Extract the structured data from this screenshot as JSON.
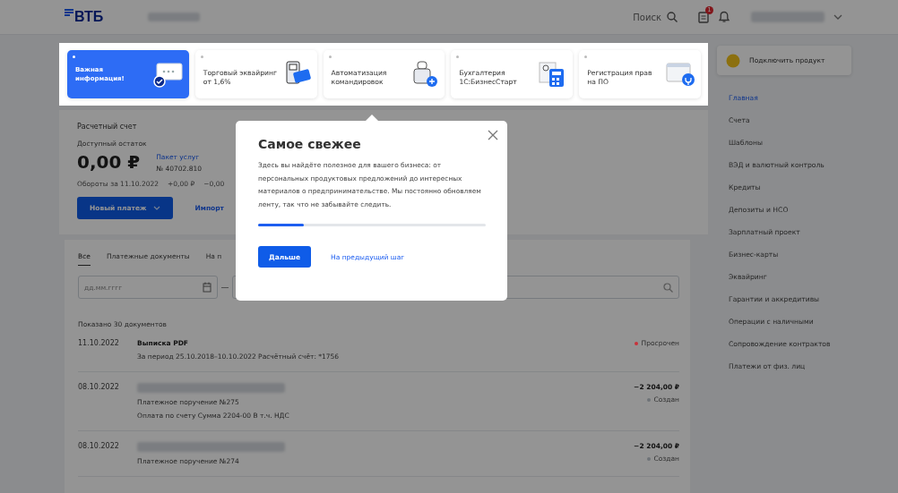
{
  "header": {
    "logo": "ВТБ",
    "search_label": "Поиск",
    "notification_badge": "1"
  },
  "stories": [
    {
      "text": "Важная информация!",
      "selected": true,
      "kind": "info"
    },
    {
      "text": "Торговый эквайринг от 1,6%",
      "selected": false,
      "kind": "terminal"
    },
    {
      "text": "Автоматизация командировок",
      "selected": false,
      "kind": "travel"
    },
    {
      "text": "Бухгалтерия 1С:БизнесСтарт",
      "selected": false,
      "kind": "calculator"
    },
    {
      "text": "Регистрация прав на ПО",
      "selected": false,
      "kind": "software"
    }
  ],
  "account": {
    "title": "Расчетный счет",
    "balance_label": "Доступный остаток",
    "balance": "0,00 ₽",
    "package_link": "Пакет услуг",
    "account_number": "№ 40702.810",
    "turnover_label": "Обороты за 11.10.2022",
    "turnover_in": "+0,00 ₽",
    "turnover_out": "−0,00",
    "new_payment_button": "Новый платеж",
    "import_link": "Импорт"
  },
  "documents": {
    "tabs": [
      {
        "label": "Все",
        "selected": true
      },
      {
        "label": "Платежные документы",
        "selected": false
      },
      {
        "label": "На п",
        "selected": false
      }
    ],
    "date_placeholder": "дд.мм.гггг",
    "count": "Показано 30 документов",
    "rows": [
      {
        "date": "11.10.2022",
        "title": "Выписка PDF",
        "lines": [
          "За период 25.10.2018–10.10.2022 Расчётный счёт: *1756"
        ],
        "amount": "",
        "status": "Просрочен",
        "color": "#c8323a",
        "counterparty_hidden": false
      },
      {
        "date": "08.10.2022",
        "title": "",
        "lines": [
          "Платежное поручение №275",
          "Оплата по счету Сумма 2204-00 В т.ч. НДС"
        ],
        "amount": "−2 204,00 ₽",
        "status": "Создан",
        "color": "#6e7378",
        "counterparty_hidden": true
      },
      {
        "date": "08.10.2022",
        "title": "",
        "lines": [
          "Платежное поручение №274"
        ],
        "amount": "−2 204,00 ₽",
        "status": "Создан",
        "color": "#6e7378",
        "counterparty_hidden": true
      }
    ]
  },
  "sidebar": {
    "connect_button": "Подключить продукт",
    "items": [
      {
        "label": "Главная",
        "selected": true
      },
      {
        "label": "Счета",
        "selected": false
      },
      {
        "label": "Шаблоны",
        "selected": false
      },
      {
        "label": "ВЭД и валютный контроль",
        "selected": false
      },
      {
        "label": "Кредиты",
        "selected": false
      },
      {
        "label": "Депозиты и НСО",
        "selected": false
      },
      {
        "label": "Зарплатный проект",
        "selected": false
      },
      {
        "label": "Бизнес-карты",
        "selected": false
      },
      {
        "label": "Эквайринг",
        "selected": false
      },
      {
        "label": "Гарантии и аккредитивы",
        "selected": false
      },
      {
        "label": "Операции с наличными",
        "selected": false
      },
      {
        "label": "Сопровождение контрактов",
        "selected": false
      },
      {
        "label": "Платежи от физ. лиц",
        "selected": false
      }
    ]
  },
  "popup": {
    "title": "Самое свежее",
    "text": "Здесь вы найдёте полезное для вашего бизнеса: от персональных продуктовых предложений до интересных материалов о предпринимательстве. Мы постоянно обновляем ленту, так что не забывайте следить.",
    "level": 0.2,
    "next_button": "Дальше",
    "back_link": "На предыдущий шаг"
  }
}
